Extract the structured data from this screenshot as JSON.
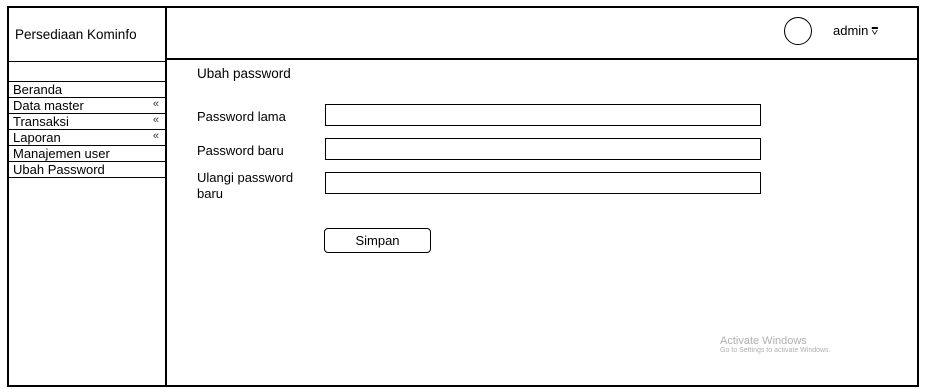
{
  "sidebar": {
    "brand": "Persediaan Kominfo",
    "items": [
      {
        "label": "Beranda",
        "arrow": ""
      },
      {
        "label": "Data master",
        "arrow": "«"
      },
      {
        "label": "Transaksi",
        "arrow": "«"
      },
      {
        "label": "Laporan",
        "arrow": "«"
      },
      {
        "label": "Manajemen user",
        "arrow": ""
      },
      {
        "label": "Ubah Password",
        "arrow": ""
      }
    ]
  },
  "header": {
    "username": "admin",
    "user_menu_icon": "chevron-down-icon"
  },
  "main": {
    "title": "Ubah password",
    "fields": [
      {
        "label": "Password lama",
        "value": ""
      },
      {
        "label": "Password baru",
        "value": ""
      },
      {
        "label": "Ulangi password baru",
        "value": ""
      }
    ],
    "submit_label": "Simpan"
  },
  "watermark": {
    "line1": "Activate Windows",
    "line2": "Go to Settings to activate Windows."
  }
}
